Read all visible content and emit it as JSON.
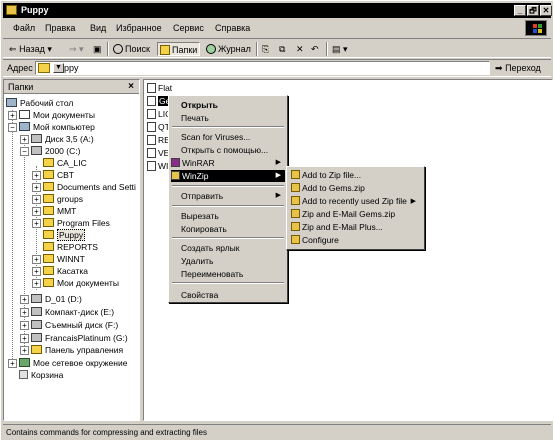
{
  "window": {
    "title": "Puppy",
    "buttons": {
      "minimize": "_",
      "maximize": "🗗",
      "close": "✕"
    }
  },
  "menubar": [
    "Файл",
    "Правка",
    "Вид",
    "Избранное",
    "Сервис",
    "Справка"
  ],
  "toolbar": {
    "back": "Назад",
    "search": "Поиск",
    "folders": "Папки",
    "history": "Журнал"
  },
  "address": {
    "label": "Адрес",
    "value": "Puppy",
    "go": "Переход"
  },
  "folders_pane": {
    "title": "Папки",
    "close": "×",
    "items": [
      "Рабочий стол",
      "Мои документы",
      "Мой компьютер",
      "Диск 3,5 (A:)",
      "2000 (C:)",
      "CA_LIC",
      "CBT",
      "Documents and Setti",
      "groups",
      "MMT",
      "Program Files",
      "Puppy",
      "REPORTS",
      "WINNT",
      "Касатка",
      "Мои документы",
      "D_01 (D:)",
      "Компакт-диск (E:)",
      "Съемный диск (F:)",
      "FrancaisPlatinum (G:)",
      "Панель управления",
      "Мое сетевое окружение",
      "Корзина"
    ]
  },
  "files": [
    "Flat",
    "Ge",
    "LIC",
    "QT",
    "RE",
    "VE",
    "WI"
  ],
  "context_menu": {
    "open": "Открыть",
    "print": "Печать",
    "scan": "Scan for Viruses...",
    "open_with": "Открыть с помощью...",
    "winrar": "WinRAR",
    "winzip": "WinZip",
    "send_to": "Отправить",
    "cut": "Вырезать",
    "copy": "Копировать",
    "shortcut": "Создать ярлык",
    "delete": "Удалить",
    "rename": "Переименовать",
    "properties": "Свойства"
  },
  "winzip_submenu": [
    "Add to Zip file...",
    "Add to Gems.zip",
    "Add to recently used Zip file",
    "Zip and E-Mail Gems.zip",
    "Zip and E-Mail Plus...",
    "Configure"
  ],
  "status": "Contains commands for compressing and extracting files"
}
